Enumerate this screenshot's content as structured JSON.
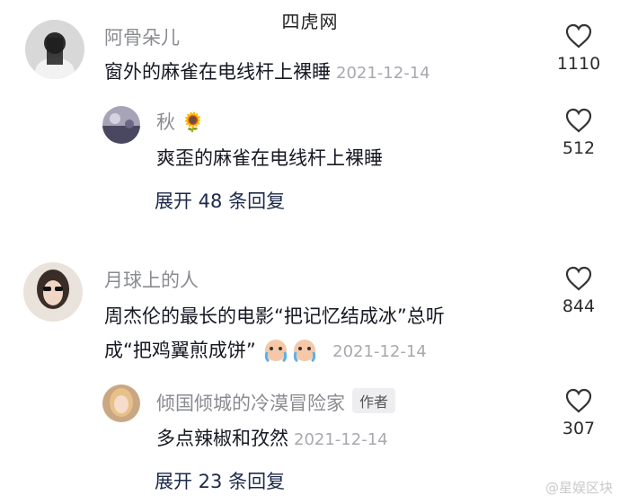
{
  "header": {
    "watermark": "四虎网"
  },
  "comments": [
    {
      "username": "阿骨朵儿",
      "text": "窗外的麻雀在电线杆上裸睡",
      "date": "2021-12-14",
      "likes": "1110",
      "reply": {
        "username": "秋",
        "username_emoji": "🌻",
        "text": "爽歪的麻雀在电线杆上裸睡",
        "likes": "512"
      },
      "expand_label": "展开 48 条回复"
    },
    {
      "username": "月球上的人",
      "text_line1": "周杰伦的最长的电影“把记忆结成冰”总听",
      "text_line2": "成“把鸡翼煎成饼”",
      "date": "2021-12-14",
      "likes": "844",
      "reply": {
        "username": "倾国倾城的冷漠冒险家",
        "badge": "作者",
        "text": "多点辣椒和孜然",
        "date": "2021-12-14",
        "likes": "307"
      },
      "expand_label": "展开 23 条回复"
    }
  ],
  "footer": {
    "watermark": "@星娱区块"
  },
  "colors": {
    "username": "#8a8b91",
    "text": "#161823",
    "date": "#a8a9ae",
    "expand": "#1c2a4a"
  }
}
